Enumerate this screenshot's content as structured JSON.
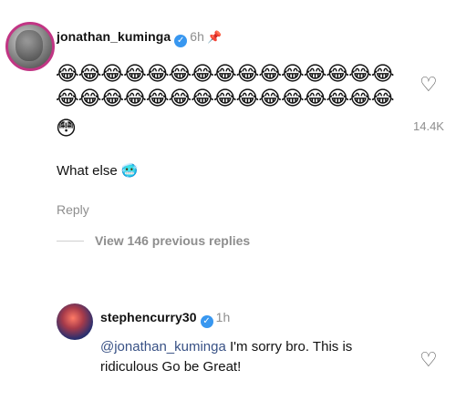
{
  "comment": {
    "username": "jonathan_kuminga",
    "time": "6h",
    "emoji_row_1": "😂😂😂😂😂😂😂😂😂😂😂😂😂😂😂",
    "emoji_row_2": "😂😂😂😂😂😂😂😂😂😂😂😂😂😂😂",
    "emoji_row_3": "😳",
    "text": "What else",
    "text_emoji": "🥶",
    "reply_label": "Reply",
    "like_count": "14.4K",
    "view_replies": "View 146 previous replies"
  },
  "reply": {
    "username": "stephencurry30",
    "time": "1h",
    "mention": "@jonathan_kuminga",
    "text_line1": " I'm sorry bro. This is",
    "text_line2": "ridiculous Go be Great!"
  },
  "icons": {
    "verified": "verified-badge-icon",
    "pin": "pin-icon",
    "heart": "heart-icon"
  },
  "colors": {
    "verified": "#3897f0",
    "mention": "#385185",
    "muted": "#8e8e8e"
  }
}
